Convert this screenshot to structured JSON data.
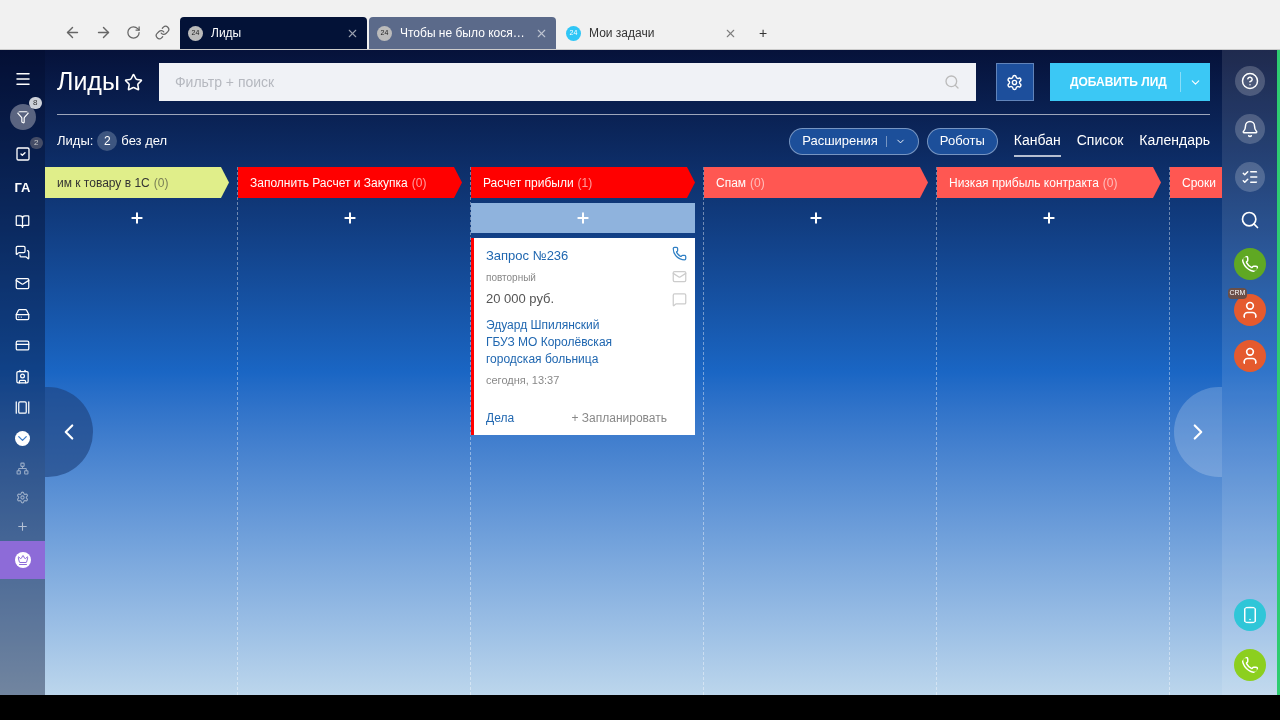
{
  "browser": {
    "tabs": [
      {
        "badge": "24",
        "title": "Лиды",
        "selected": true
      },
      {
        "badge": "24",
        "title": "Чтобы не было кося…",
        "selected": false
      },
      {
        "badge": "24",
        "title": "Мои задачи",
        "selected": false
      }
    ],
    "new_tab": "+"
  },
  "left_sidebar": {
    "filter_counter": "8",
    "tasks_counter": "2",
    "label": "ГА"
  },
  "header": {
    "title": "Лиды",
    "search_placeholder": "Фильтр + поиск",
    "add_button": "ДОБАВИТЬ ЛИД"
  },
  "toolbar": {
    "counter_label": "Лиды:",
    "counter": "2",
    "counter_suffix": "без дел",
    "extensions_button": "Расширения",
    "robots_button": "Роботы",
    "views": [
      {
        "label": "Канбан",
        "selected": true
      },
      {
        "label": "Список",
        "selected": false
      },
      {
        "label": "Календарь",
        "selected": false
      }
    ]
  },
  "columns": [
    {
      "title": "им к товару в 1С",
      "count": "(0)",
      "color": "#e0ee8a",
      "add_highlighted": false
    },
    {
      "title": "Заполнить Расчет и Закупка",
      "count": "(0)",
      "color": "#ff0000",
      "add_highlighted": false
    },
    {
      "title": "Расчет прибыли",
      "count": "(1)",
      "color": "#ff0000",
      "add_highlighted": true,
      "cards": [
        {
          "title": "Запрос №236",
          "subtitle": "повторный",
          "price": "20 000 руб.",
          "contact": "Эдуард Шпилянский",
          "company": "ГБУЗ МО Королёвская городская больница",
          "time": "сегодня, 13:37",
          "activities": "Дела",
          "plan": "+ Запланировать"
        }
      ]
    },
    {
      "title": "Спам",
      "count": "(0)",
      "color": "#ff5752",
      "add_highlighted": false
    },
    {
      "title": "Низкая прибыль контракта",
      "count": "(0)",
      "color": "#ff5752",
      "add_highlighted": false
    },
    {
      "title": "Сроки",
      "color": "#ff5752"
    }
  ],
  "right_sidebar": {
    "crm_badge": "CRM"
  }
}
